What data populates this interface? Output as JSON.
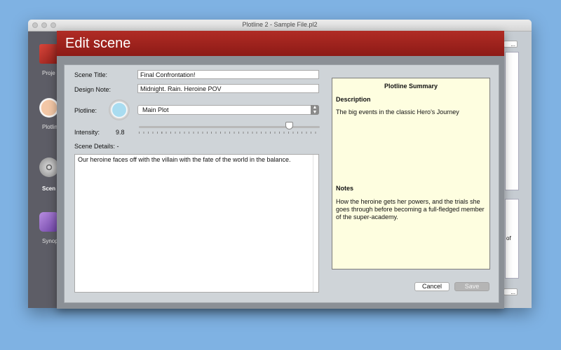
{
  "window": {
    "title": "Plotline 2 - Sample File.pl2"
  },
  "sidebar": {
    "items": [
      {
        "label": "Proje",
        "icon": "project-icon"
      },
      {
        "label": "Plotlin",
        "icon": "plotline-icon"
      },
      {
        "label": "Scen",
        "icon": "scene-reel-icon"
      },
      {
        "label": "Synop",
        "icon": "synopsis-pen-icon"
      }
    ]
  },
  "background": {
    "button_text": "...",
    "fragment_text": "of"
  },
  "dialog": {
    "title": "Edit scene",
    "scene_title_label": "Scene Title:",
    "scene_title_value": "Final Confrontation!",
    "design_note_label": "Design Note:",
    "design_note_value": "Midnight. Rain. Heroine POV",
    "plotline_label": "Plotline:",
    "plotline_value": "Main Plot",
    "plotline_color": "#a9dcf0",
    "intensity_label": "Intensity:",
    "intensity_value": "9.8",
    "intensity_fraction": 0.83,
    "details_label": "Scene Details: -",
    "details_text": "Our heroine faces off with the villain with the fate of the world in the balance.",
    "cancel_label": "Cancel",
    "save_label": "Save"
  },
  "summary": {
    "title": "Plotline Summary",
    "description_heading": "Description",
    "description_text": "The big events in the classic Hero's Journey",
    "notes_heading": "Notes",
    "notes_text": "How the heroine gets her powers, and the trials she goes through before becoming a full-fledged member of the super-academy."
  },
  "colors": {
    "header_red": "#9f2520",
    "summary_bg": "#fefee0",
    "desktop": "#7fb2e3"
  }
}
